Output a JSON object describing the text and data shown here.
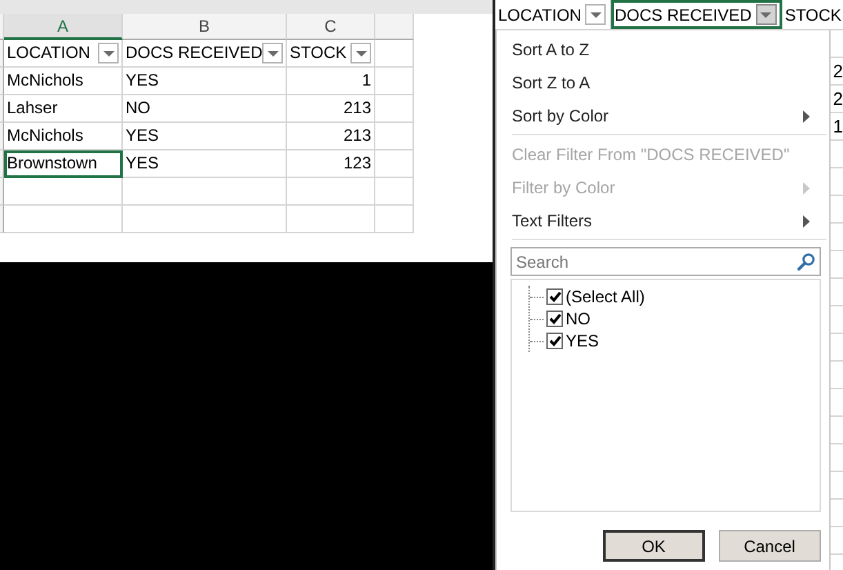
{
  "sheet": {
    "columns": [
      {
        "letter": "A",
        "selected": true
      },
      {
        "letter": "B",
        "selected": false
      },
      {
        "letter": "C",
        "selected": false
      }
    ],
    "headers": [
      "LOCATION",
      "DOCS RECEIVED",
      "STOCK"
    ],
    "rows": [
      [
        {
          "text": "McNichols",
          "active": false
        },
        {
          "text": "YES",
          "active": false
        },
        {
          "text": "1",
          "active": false
        }
      ],
      [
        {
          "text": "Lahser",
          "active": false
        },
        {
          "text": "NO",
          "active": false
        },
        {
          "text": "213",
          "active": false
        }
      ],
      [
        {
          "text": "McNichols",
          "active": false
        },
        {
          "text": "YES",
          "active": false
        },
        {
          "text": "213",
          "active": false
        }
      ],
      [
        {
          "text": "Brownstown",
          "active": true
        },
        {
          "text": "YES",
          "active": false
        },
        {
          "text": "123",
          "active": false
        }
      ]
    ]
  },
  "filter_view": {
    "headers": [
      {
        "text": "LOCATION",
        "selected": false,
        "filter_button": true
      },
      {
        "text": "DOCS RECEIVED",
        "selected": true,
        "filter_button": true
      },
      {
        "text": "STOCK",
        "selected": false,
        "filter_button": false
      }
    ],
    "menu": {
      "items": [
        {
          "kind": "item",
          "label": "Sort A to Z",
          "disabled": false,
          "submenu": false
        },
        {
          "kind": "item",
          "label": "Sort Z to A",
          "disabled": false,
          "submenu": false
        },
        {
          "kind": "item",
          "label": "Sort by Color",
          "disabled": false,
          "submenu": true
        },
        {
          "kind": "separator"
        },
        {
          "kind": "item",
          "label": "Clear Filter From \"DOCS RECEIVED\"",
          "disabled": true,
          "submenu": false
        },
        {
          "kind": "item",
          "label": "Filter by Color",
          "disabled": true,
          "submenu": true
        },
        {
          "kind": "item",
          "label": "Text Filters",
          "disabled": false,
          "submenu": true
        },
        {
          "kind": "separator"
        }
      ],
      "search": {
        "placeholder": "Search"
      },
      "values": [
        {
          "label": "(Select All)",
          "checked": true,
          "children": [
            {
              "label": "NO",
              "checked": true
            },
            {
              "label": "YES",
              "checked": true
            }
          ]
        }
      ],
      "buttons": [
        {
          "label": "OK",
          "default": true
        },
        {
          "label": "Cancel",
          "default": false
        }
      ]
    },
    "cut_cells": [
      "2",
      "2",
      "1"
    ]
  }
}
